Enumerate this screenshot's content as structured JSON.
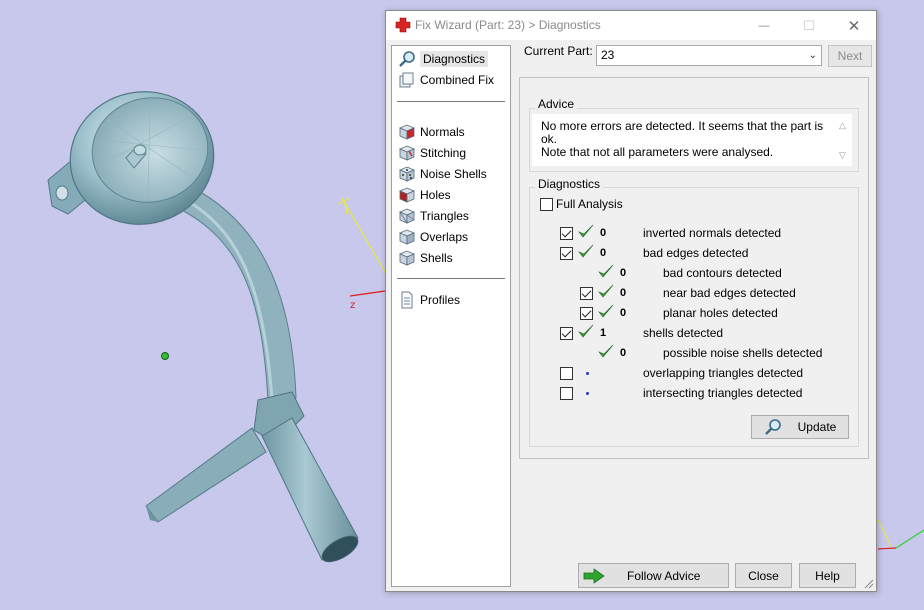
{
  "window": {
    "title": "Fix Wizard (Part: 23) > Diagnostics",
    "min_glyph": "—",
    "max_glyph": "☐",
    "close_glyph": "✕"
  },
  "nav": {
    "items": [
      {
        "label": "Diagnostics",
        "icon": "magnifier-icon",
        "selected": true
      },
      {
        "label": "Combined Fix",
        "icon": "stacked-pages-icon"
      },
      {
        "label": "Normals",
        "icon": "cube-red-face-icon"
      },
      {
        "label": "Stitching",
        "icon": "cube-stitch-icon"
      },
      {
        "label": "Noise Shells",
        "icon": "cube-dots-icon"
      },
      {
        "label": "Holes",
        "icon": "cube-red-icon"
      },
      {
        "label": "Triangles",
        "icon": "cube-triangles-icon"
      },
      {
        "label": "Overlaps",
        "icon": "cube-overlap-icon"
      },
      {
        "label": "Shells",
        "icon": "cube-shell-icon"
      },
      {
        "label": "Profiles",
        "icon": "document-icon"
      }
    ]
  },
  "current_part": {
    "label": "Current Part:",
    "value": "23"
  },
  "buttons": {
    "next": "Next",
    "update": "Update",
    "follow_advice": "Follow Advice",
    "close": "Close",
    "help": "Help"
  },
  "advice": {
    "title": "Advice",
    "line1": "No more errors are detected. It seems that the part is ok.",
    "line2": "Note that not all parameters were analysed."
  },
  "diagnostics": {
    "title": "Diagnostics",
    "full_analysis_label": "Full Analysis",
    "full_analysis_checked": false,
    "rows": [
      {
        "checkbox": true,
        "checked": true,
        "status": "ok",
        "count": "0",
        "label": "inverted normals detected",
        "indent": 0
      },
      {
        "checkbox": true,
        "checked": true,
        "status": "ok",
        "count": "0",
        "label": "bad edges detected",
        "indent": 0
      },
      {
        "checkbox": false,
        "checked": false,
        "status": "ok",
        "count": "0",
        "label": "bad contours detected",
        "indent": 1
      },
      {
        "checkbox": true,
        "checked": true,
        "status": "ok",
        "count": "0",
        "label": "near bad edges detected",
        "indent": 1
      },
      {
        "checkbox": true,
        "checked": true,
        "status": "ok",
        "count": "0",
        "label": "planar holes detected",
        "indent": 1
      },
      {
        "checkbox": true,
        "checked": true,
        "status": "ok",
        "count": "1",
        "label": "shells detected",
        "indent": 0
      },
      {
        "checkbox": false,
        "checked": false,
        "status": "ok",
        "count": "0",
        "label": "possible noise shells detected",
        "indent": 1
      },
      {
        "checkbox": true,
        "checked": false,
        "status": "pending",
        "count": "",
        "label": "overlapping triangles detected",
        "indent": 0
      },
      {
        "checkbox": true,
        "checked": false,
        "status": "pending",
        "count": "",
        "label": "intersecting triangles detected",
        "indent": 0
      }
    ]
  },
  "viewport": {
    "axis_label_z": "z",
    "background_color": "#c8c8ec",
    "model_color": "#8fb5c2"
  },
  "colors": {
    "tick_green": "#3b9a3b",
    "arrow_green": "#2fa52f"
  }
}
